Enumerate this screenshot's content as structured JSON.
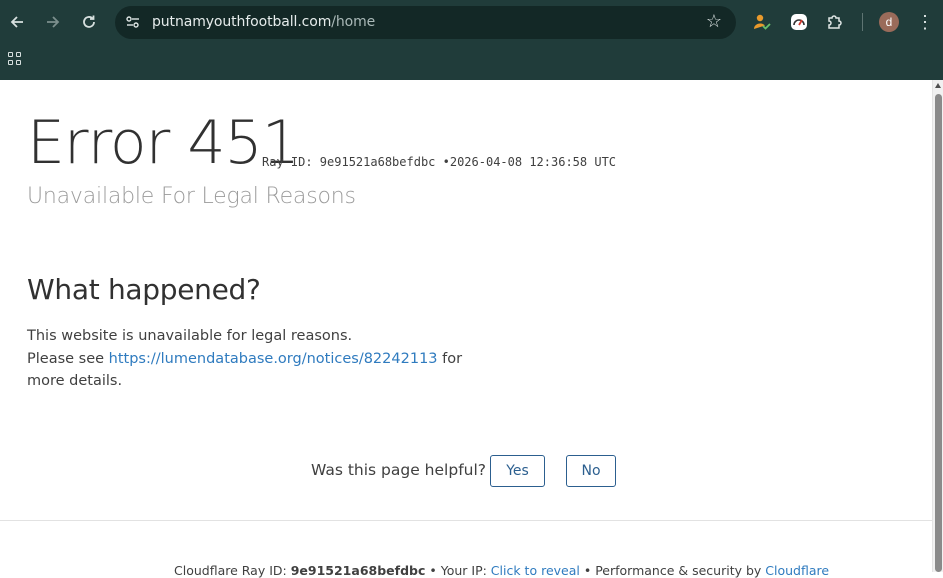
{
  "browser": {
    "url_domain": "putnamyouthfootball.com",
    "url_path": "/home",
    "profile_initial": "d",
    "icons": {
      "back": "arrow-left-icon",
      "forward": "arrow-right-icon",
      "reload": "reload-icon",
      "site_info": "tune-icon",
      "bookmark": "star-icon",
      "extensions": "puzzle-icon",
      "menu": "kebab-menu-icon",
      "apps": "apps-grid-icon"
    }
  },
  "page": {
    "error_title": "Error 451",
    "ray_id_label": "Ray ID: 9e91521a68befdbc",
    "separator": "•",
    "timestamp": "2026-04-08 12:36:58 UTC",
    "subtitle": "Unavailable For Legal Reasons",
    "what_heading": "What happened?",
    "para_line1": "This website is unavailable for legal reasons.",
    "para_prefix": "Please see ",
    "para_link": "https://lumendatabase.org/notices/82242113",
    "para_suffix": " for more details.",
    "helpful_question": "Was this page helpful?",
    "yes_label": "Yes",
    "no_label": "No"
  },
  "footer": {
    "ray_label": "Cloudflare Ray ID: ",
    "ray_value": "9e91521a68befdbc",
    "bullet": " • ",
    "ip_label": "Your IP: ",
    "ip_link": "Click to reveal",
    "perf_label": "Performance & security by ",
    "cloudflare_link": "Cloudflare"
  },
  "colors": {
    "chrome_bg": "#203c3a",
    "omnibox_bg": "#132826",
    "link": "#2f7bbf",
    "button_border": "#2c5f8f"
  }
}
